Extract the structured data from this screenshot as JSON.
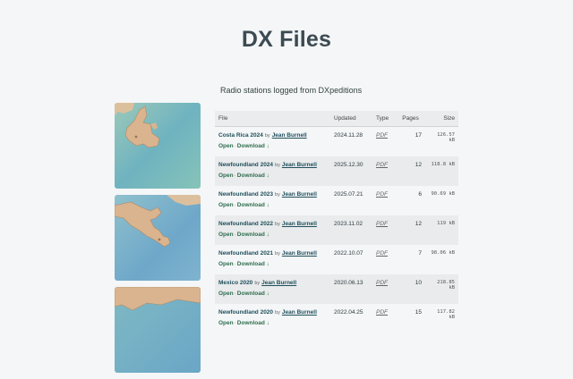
{
  "page": {
    "title": "DX Files",
    "subtitle": "Radio stations logged from DXpeditions"
  },
  "table": {
    "headers": {
      "file": "File",
      "updated": "Updated",
      "type": "Type",
      "pages": "Pages",
      "size": "Size"
    },
    "by_label": "by",
    "open_label": "Open",
    "separator": "·",
    "download_label": "Download ↓",
    "rows": [
      {
        "name": "Costa Rica 2024",
        "author": "Jean Burnell",
        "updated": "2024.11.28",
        "type": "PDF",
        "pages": "17",
        "size": "126.57 kB"
      },
      {
        "name": "Newfoundland 2024",
        "author": "Jean Burnell",
        "updated": "2025.12.30",
        "type": "PDF",
        "pages": "12",
        "size": "118.8 kB"
      },
      {
        "name": "Newfoundland 2023",
        "author": "Jean Burnell",
        "updated": "2025.07.21",
        "type": "PDF",
        "pages": "6",
        "size": "90.69 kB"
      },
      {
        "name": "Newfoundland 2022",
        "author": "Jean Burnell",
        "updated": "2023.11.02",
        "type": "PDF",
        "pages": "12",
        "size": "119 kB"
      },
      {
        "name": "Newfoundland 2021",
        "author": "Jean Burnell",
        "updated": "2022.10.07",
        "type": "PDF",
        "pages": "7",
        "size": "98.06 kB"
      },
      {
        "name": "Mexico 2020",
        "author": "Jean Burnell",
        "updated": "2020.06.13",
        "type": "PDF",
        "pages": "10",
        "size": "218.85 kB"
      },
      {
        "name": "Newfoundland 2020",
        "author": "Jean Burnell",
        "updated": "2022.04.25",
        "type": "PDF",
        "pages": "15",
        "size": "117.82 kB"
      }
    ]
  },
  "thumbnails": [
    {
      "name": "newfoundland-map-thumbnail"
    },
    {
      "name": "central-america-map-thumbnail"
    },
    {
      "name": "mexico-coast-map-thumbnail"
    }
  ],
  "colors": {
    "background": "#f4f6f7",
    "title": "#3c4a52",
    "link": "#1f4f5c",
    "action": "#2f6e4e",
    "row_alt": "#e9ebec",
    "sea": "#7fb9c4",
    "land": "#d9b48f"
  }
}
